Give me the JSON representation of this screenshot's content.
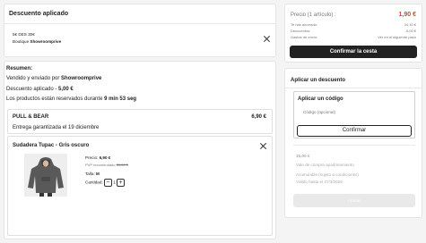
{
  "discount_card": {
    "title": "Descuento aplicado",
    "code_line": "5€ DES 30€",
    "shop_prefix": "Boutique ",
    "shop_name": "Showroomprive"
  },
  "summary": {
    "title": "Resumen:",
    "sold_by_prefix": "Vendido y enviado por ",
    "sold_by_name": "Showroomprive",
    "discount_prefix": "Descuento aplicado - ",
    "discount_value": "5,00 €",
    "reserved_prefix": "Los productos están reservados durante ",
    "reserved_time": "9 min 53 seg"
  },
  "shipment": {
    "brand": "PULL & BEAR",
    "price": "6,90 €",
    "delivery": "Entrega garantizada el 19 diciembre"
  },
  "product": {
    "name": "Sudadera Tupac - Gris oscuro",
    "price_label": "Precio: ",
    "price": "6,90 €",
    "pvp_label": "PVP recomendado ",
    "pvp_value": "35,00 €",
    "size_label": "Talla: ",
    "size": "M",
    "qty_label": "Cantidad:",
    "qty_minus": "−",
    "qty": "1",
    "qty_plus": "+"
  },
  "totals": {
    "subtotal_label": "Precio (1 artículo) :",
    "subtotal_value": "1,90 €",
    "rows": [
      {
        "label": "Te has ahorrado:",
        "value": "34,10 €"
      },
      {
        "label": "Descuentos:",
        "value": "-5,00 €"
      },
      {
        "label": "Gastos de envío:",
        "value": "Ver en el siguiente paso"
      }
    ],
    "confirm_label": "Confirmar la cesta",
    "accent_color": "#e53935"
  },
  "coupon": {
    "title": "Aplicar un descuento",
    "code_title": "Aplicar un código",
    "placeholder": "Código (opcional)",
    "confirm_label": "Confirmar",
    "voucher_amount": "15,00 €",
    "voucher_desc": "Vale de compra apadrinamiento",
    "voucher_note1": "Acumulable (sujeto a condiciones)",
    "voucher_note2": "Válido hasta el 27/3/2026",
    "apply_label": "Aplicar"
  }
}
